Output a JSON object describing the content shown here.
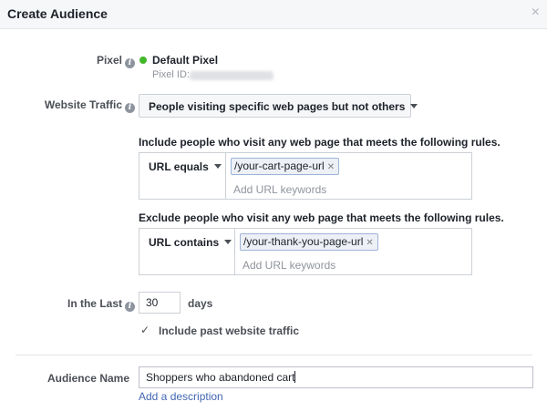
{
  "dialog": {
    "title": "Create Audience",
    "close_glyph": "×"
  },
  "pixel": {
    "label": "Pixel",
    "name": "Default Pixel",
    "id_label": "Pixel ID:",
    "status_color": "#42b72a"
  },
  "website_traffic": {
    "label": "Website Traffic",
    "selected": "People visiting specific web pages but not others"
  },
  "include_rule": {
    "text": "Include people who visit any web page that meets the following rules.",
    "operator": "URL equals",
    "tokens": [
      "/your-cart-page-url"
    ],
    "placeholder": "Add URL keywords"
  },
  "exclude_rule": {
    "text": "Exclude people who visit any web page that meets the following rules.",
    "operator": "URL contains",
    "tokens": [
      "/your-thank-you-page-url"
    ],
    "placeholder": "Add URL keywords"
  },
  "in_the_last": {
    "label": "In the Last",
    "value": "30",
    "unit": "days"
  },
  "past_traffic": {
    "checked": true,
    "label": "Include past website traffic"
  },
  "audience_name": {
    "label": "Audience Name",
    "value": "Shoppers who abandoned cart",
    "add_description": "Add a description"
  },
  "colors": {
    "link": "#4267b2",
    "token_border": "#9cb4d8",
    "token_bg": "#edf0f5"
  }
}
